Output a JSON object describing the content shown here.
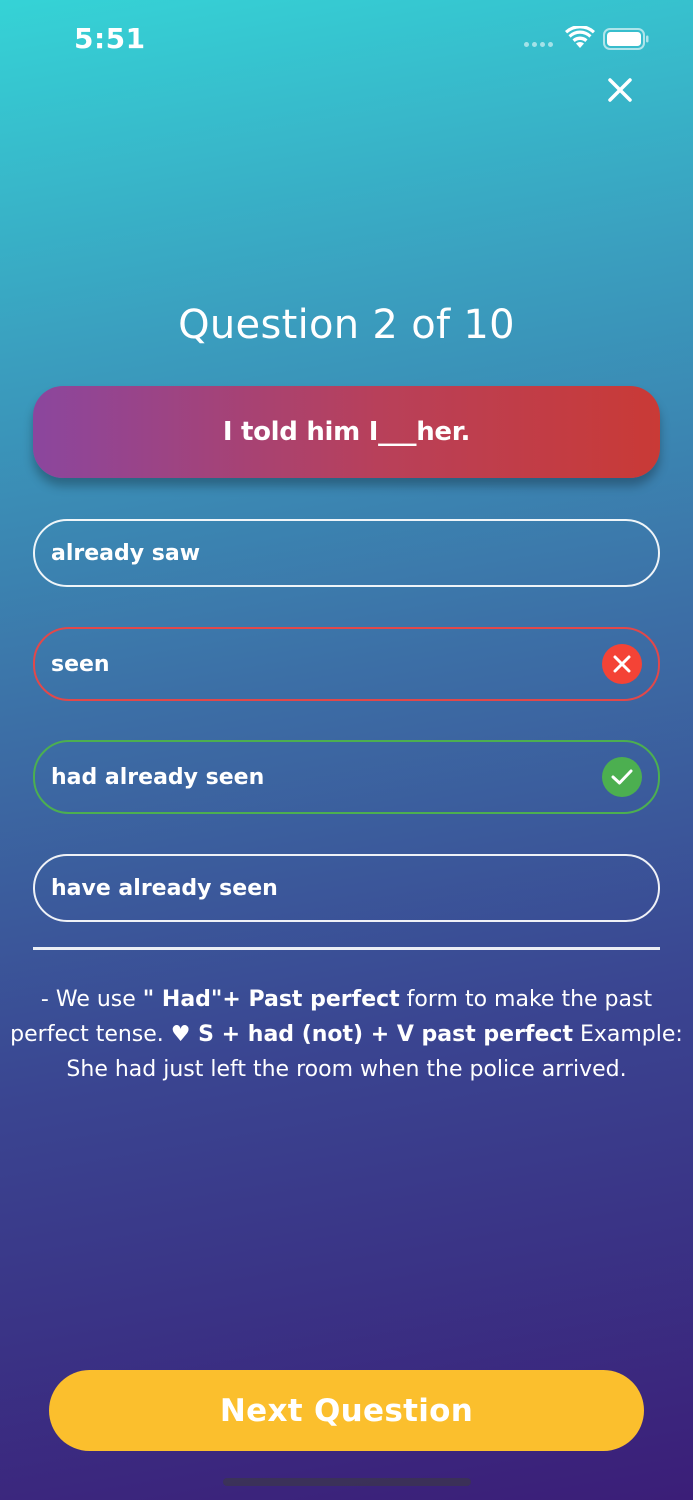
{
  "status_bar": {
    "time": "5:51",
    "icons": [
      "signal-dots-icon",
      "wifi-icon",
      "battery-icon"
    ]
  },
  "header": {
    "close_icon": "close-icon"
  },
  "quiz": {
    "counter": "Question 2 of 10",
    "question": "I told him I___her.",
    "options": [
      {
        "label": "already saw",
        "state": "neutral"
      },
      {
        "label": "seen",
        "state": "wrong",
        "icon": "wrong-icon"
      },
      {
        "label": "had already seen",
        "state": "correct",
        "icon": "check-icon"
      },
      {
        "label": "have already seen",
        "state": "neutral"
      }
    ],
    "explanation": {
      "p1": "- We use ",
      "b1": "\" Had\"+ Past perfect",
      "p2": " form to make the past perfect tense. ",
      "b2": "♥ S + had (not) + V past perfect",
      "p3": " Example: She had just left the room when the police arrived."
    }
  },
  "footer": {
    "next_label": "Next Question"
  },
  "colors": {
    "accent_button": "#fbbf2d",
    "wrong": "#f44336",
    "correct": "#4caf50",
    "question_gradient_start": "#8b469e",
    "question_gradient_end": "#c93a36"
  }
}
